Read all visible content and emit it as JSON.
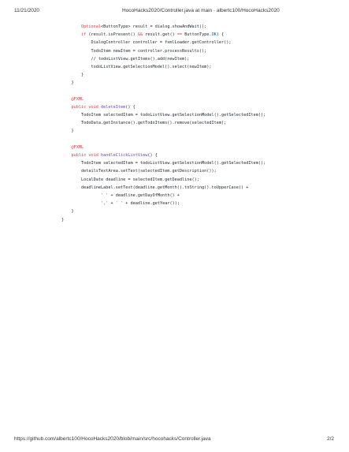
{
  "header": {
    "date": "11/21/2020",
    "title": "HocoHacks2020/Controller.java at main · albertc100/HocoHacks2020"
  },
  "footer": {
    "url": "https://github.com/albertc100/HocoHacks2020/blob/main/src/hocohacks/Controller.java",
    "page": "2/2"
  },
  "code_lines": [
    [
      [
        "        ",
        ""
      ],
      [
        "Optional",
        "kw"
      ],
      [
        "<ButtonType> result = dialog.showAndWait();",
        ""
      ]
    ],
    [
      [
        "        ",
        ""
      ],
      [
        "if",
        "kw"
      ],
      [
        " (result.isPresent() ",
        ""
      ],
      [
        "&&",
        "kw"
      ],
      [
        " result.get() ",
        ""
      ],
      [
        "==",
        "kw"
      ],
      [
        " ButtonType.",
        ""
      ],
      [
        "OK",
        "cst"
      ],
      [
        ") {",
        ""
      ]
    ],
    [
      [
        "            DialogController controller = fxmlLoader.getController();",
        ""
      ]
    ],
    [
      [
        "            TodoItem newItem = controller.processResults();",
        ""
      ]
    ],
    [
      [
        "            ",
        ""
      ],
      [
        "// todoListView.getItems().add(newItem);",
        "cm"
      ]
    ],
    [
      [
        "            todoListView.getSelectionModel().select(newItem);",
        ""
      ]
    ],
    [
      [
        "        }",
        ""
      ]
    ],
    [
      [
        "    }",
        ""
      ]
    ],
    [
      [
        "",
        ""
      ]
    ],
    [
      [
        "    ",
        ""
      ],
      [
        "@FXML",
        "ann"
      ]
    ],
    [
      [
        "    ",
        ""
      ],
      [
        "public",
        "kw"
      ],
      [
        " ",
        ""
      ],
      [
        "void",
        "kw"
      ],
      [
        " ",
        ""
      ],
      [
        "deleteItem",
        "fn"
      ],
      [
        "() {",
        ""
      ]
    ],
    [
      [
        "        TodoItem selectedItem = todoListView.getSelectionModel().getSelectedItem();",
        ""
      ]
    ],
    [
      [
        "        TodoData.getInstance().getTodoItems().remove(selectedItem);",
        ""
      ]
    ],
    [
      [
        "    }",
        ""
      ]
    ],
    [
      [
        "",
        ""
      ]
    ],
    [
      [
        "    ",
        ""
      ],
      [
        "@FXML",
        "ann"
      ]
    ],
    [
      [
        "    ",
        ""
      ],
      [
        "public",
        "kw"
      ],
      [
        " ",
        ""
      ],
      [
        "void",
        "kw"
      ],
      [
        " ",
        ""
      ],
      [
        "handleClickListView",
        "fn"
      ],
      [
        "() {",
        ""
      ]
    ],
    [
      [
        "        TodoItem selectedItem = todoListView.getSelectionModel().getSelectedItem();",
        ""
      ]
    ],
    [
      [
        "        detailsTextArea.setText(selectedItem.getDescription());",
        ""
      ]
    ],
    [
      [
        "        LocalDate deadline = selectedItem.getDeadline();",
        ""
      ]
    ],
    [
      [
        "        deadlineLabel.setText(deadline.getMonth().toString().toUpperCase() +",
        ""
      ]
    ],
    [
      [
        "                ",
        ""
      ],
      [
        "' '",
        "kw"
      ],
      [
        " + deadline.getDayOfMonth() +",
        ""
      ]
    ],
    [
      [
        "                ",
        ""
      ],
      [
        "','",
        "kw"
      ],
      [
        " + ",
        ""
      ],
      [
        "' '",
        "kw"
      ],
      [
        " + deadline.getYear());",
        ""
      ]
    ],
    [
      [
        "    }",
        ""
      ]
    ],
    [
      [
        "}",
        ""
      ]
    ]
  ]
}
